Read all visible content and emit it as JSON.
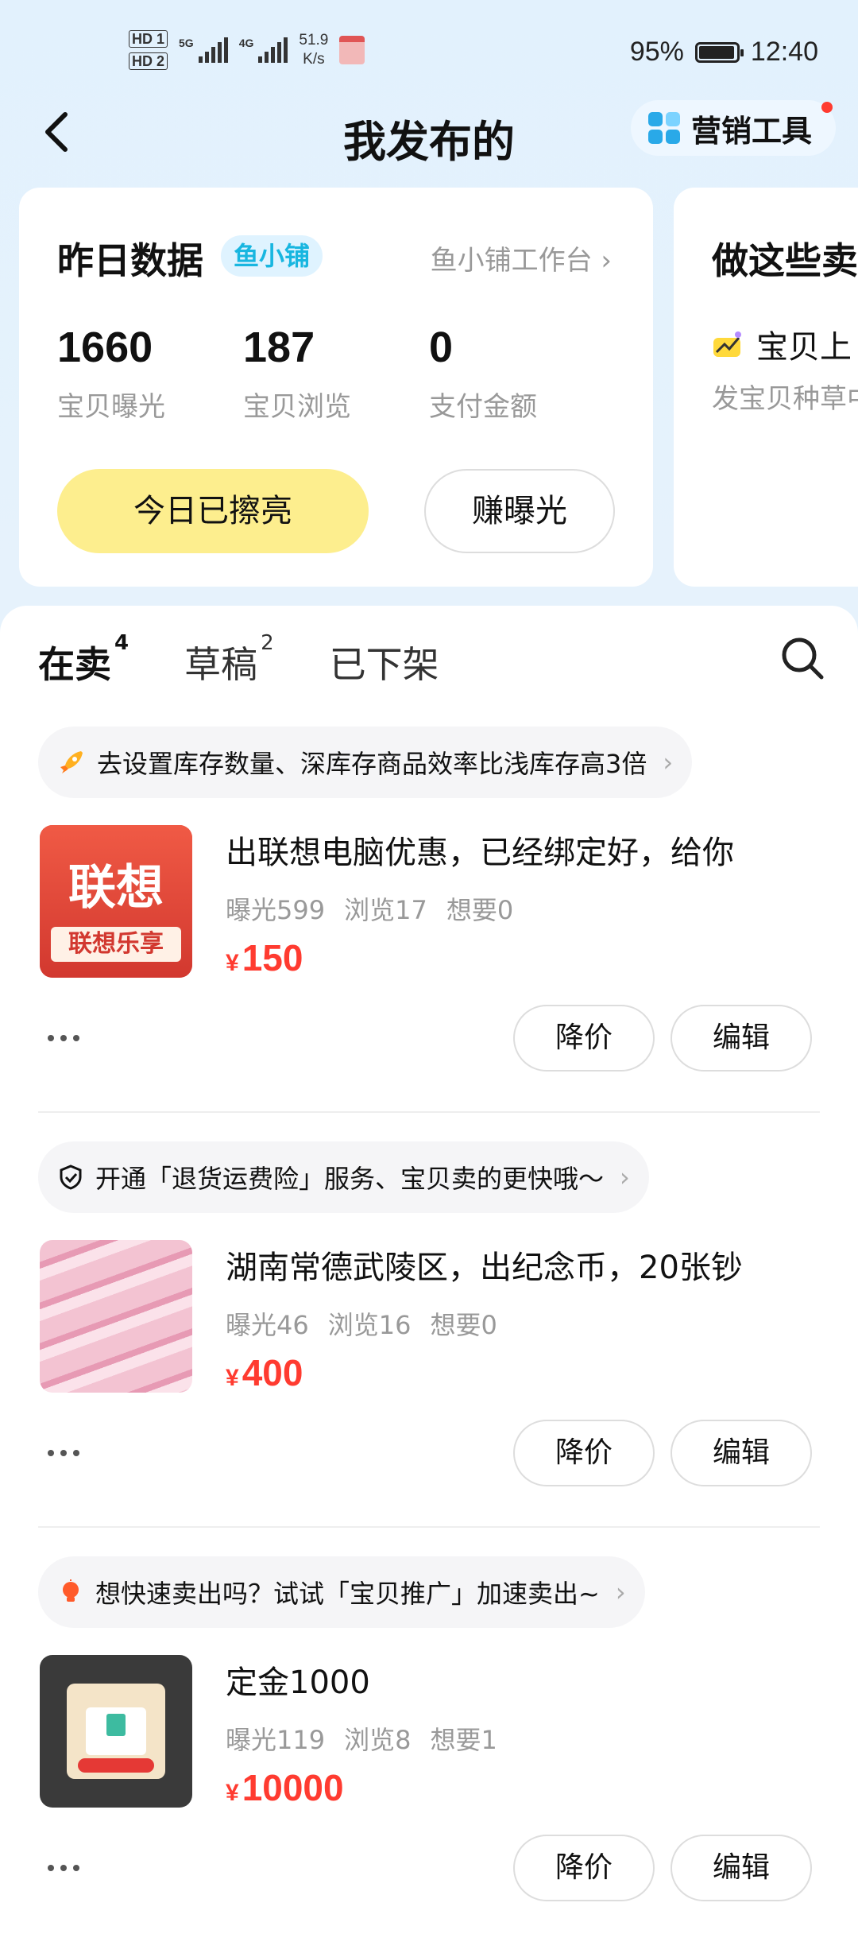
{
  "status_bar": {
    "speed_value": "51.9",
    "speed_unit": "K/s",
    "battery": "95%",
    "time": "12:40",
    "hd1": "HD 1",
    "hd2": "HD 2",
    "net1": "5G",
    "net2": "4G"
  },
  "header": {
    "title": "我发布的",
    "marketing_tools": "营销工具"
  },
  "stats_card": {
    "title": "昨日数据",
    "badge": "鱼小铺",
    "workbench": "鱼小铺工作台",
    "stats": [
      {
        "value": "1660",
        "label": "宝贝曝光"
      },
      {
        "value": "187",
        "label": "宝贝浏览"
      },
      {
        "value": "0",
        "label": "支付金额"
      }
    ],
    "primary_button": "今日已擦亮",
    "secondary_button": "赚曝光"
  },
  "tasks_card": {
    "title": "做这些卖",
    "item": "宝贝上",
    "sub": "发宝贝种草中"
  },
  "tabs": [
    {
      "label": "在卖",
      "count": "4"
    },
    {
      "label": "草稿",
      "count": "2"
    },
    {
      "label": "已下架",
      "count": ""
    }
  ],
  "items": [
    {
      "tip": "去设置库存数量、深库存商品效率比浅库存高3倍",
      "tip_icon": "rocket-icon",
      "name": "出联想电脑优惠，已经绑定好，给你",
      "thumb_text1": "联想",
      "thumb_text2": "联想乐享",
      "exposure": "曝光599",
      "views": "浏览17",
      "wants": "想要0",
      "currency": "¥",
      "price": "150",
      "reduce": "降价",
      "edit": "编辑"
    },
    {
      "tip": "开通「退货运费险」服务、宝贝卖的更快哦～",
      "tip_icon": "shield-check-icon",
      "name": "湖南常德武陵区，出纪念币，20张钞",
      "exposure": "曝光46",
      "views": "浏览16",
      "wants": "想要0",
      "currency": "¥",
      "price": "400",
      "reduce": "降价",
      "edit": "编辑"
    },
    {
      "tip": "想快速卖出吗？试试「宝贝推广」加速卖出~",
      "tip_icon": "bulb-icon",
      "name": "定金1000",
      "exposure": "曝光119",
      "views": "浏览8",
      "wants": "想要1",
      "currency": "¥",
      "price": "10000",
      "reduce": "降价",
      "edit": "编辑"
    }
  ],
  "colors": {
    "accent_red": "#ff3b30",
    "highlight_yellow": "#fdee8e",
    "badge_blue": "#18b6e0"
  }
}
